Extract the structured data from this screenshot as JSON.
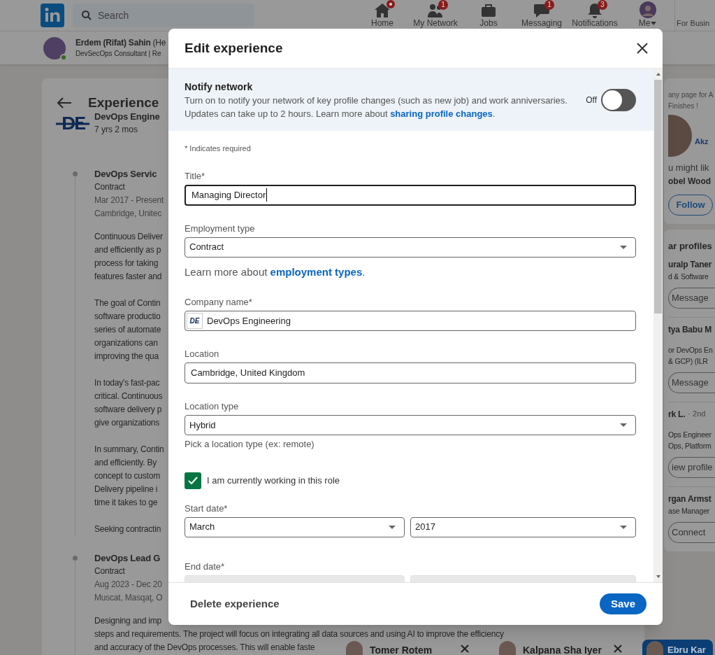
{
  "top_nav": {
    "search_placeholder": "Search",
    "items": [
      {
        "kind": "home",
        "label": "Home",
        "dot": true
      },
      {
        "kind": "network",
        "label": "My Network",
        "badge": "1"
      },
      {
        "kind": "jobs",
        "label": "Jobs"
      },
      {
        "kind": "messaging",
        "label": "Messaging",
        "badge": "1"
      },
      {
        "kind": "notifications",
        "label": "Notifications",
        "badge": "3"
      },
      {
        "kind": "me",
        "label": "Me"
      },
      {
        "kind": "business",
        "label": "For Busin"
      }
    ]
  },
  "profile_bar": {
    "name": "Erdem (Rifat) Sahin",
    "pronouns": "(He",
    "headline": "DevSecOps Consultant | Re",
    "online": true
  },
  "experience": {
    "title": "Experience",
    "company": "DevOps Engine",
    "duration": "7 yrs 2 mos",
    "roles": [
      {
        "title": "DevOps Servic",
        "type": "Contract",
        "dates": "Mar 2017 - Present",
        "location": "Cambridge, Unitec",
        "paragraphs": [
          [
            "Continuous Deliver",
            "and efficiently as p",
            "process for taking",
            "features faster and"
          ],
          [
            "The goal of Contin",
            "software productio",
            "series of automate",
            "organizations can",
            "improving the qua"
          ],
          [
            "In today's fast-pac",
            "critical. Continuous",
            "software delivery p",
            "give organizations"
          ],
          [
            "In summary, Contin",
            "and efficiently. By",
            "concept to custom",
            "Delivery pipeline i",
            "time it takes to ge"
          ],
          [
            "Seeking contractin"
          ]
        ]
      },
      {
        "title": "DevOps Lead G",
        "type": "Contract",
        "dates": "Aug 2023 - Dec 20",
        "location": "Muscat, Masqaţ, O",
        "paragraphs": [
          [
            "Designing and imp",
            "steps and requirements. The project will focus on integrating all data sources and using AI to improve the efficiency",
            "and accuracy of the DevOps processes. This will enable faste"
          ]
        ]
      }
    ]
  },
  "right_rail": {
    "ad_lines": [
      "any page for A",
      "Finishes !"
    ],
    "ad_logo": "Akz",
    "suggestion": "u might lik",
    "person": "obel Wood",
    "follow": "Follow",
    "section_title": "ar profiles",
    "profiles": [
      {
        "name": "uralp Taner",
        "lines": [
          "d & Software"
        ],
        "action": "Message"
      },
      {
        "name": "tya Babu M",
        "lines": [
          "or DevOps En",
          "& GCP) (ILR"
        ],
        "action": "Message"
      },
      {
        "name": "rk L.",
        "degree": "· 2nd",
        "lines": [
          "Ops Engineer",
          "Ops, Platform"
        ],
        "action": "iew profile"
      },
      {
        "name": "rgan Armst",
        "lines": [
          "ase Manager"
        ],
        "action": "Connect"
      }
    ]
  },
  "chat_tabs": [
    {
      "name": "Tomer Rotem",
      "selected": false
    },
    {
      "name": "Kalpana Sha Iyer",
      "selected": false
    },
    {
      "name": "Ebru Kar",
      "selected": true
    }
  ],
  "modal": {
    "title": "Edit experience",
    "notify": {
      "title": "Notify network",
      "line1": "Turn on to notify your network of key profile changes (such as new job) and work anniversaries.",
      "line2": "Updates can take up to 2 hours. Learn more about ",
      "link": "sharing profile changes",
      "suffix": ".",
      "toggle_label": "Off",
      "on": false
    },
    "required_note": "* Indicates required",
    "fields": [
      {
        "kind": "text",
        "label": "Title*",
        "value": "Managing Director",
        "focused": true
      },
      {
        "kind": "select",
        "label": "Employment type",
        "value": "Contract",
        "help": "Learn more about ",
        "help_link": "employment types",
        "help_suffix": "."
      },
      {
        "kind": "company",
        "label": "Company name*",
        "value": "DevOps Engineering",
        "logo": "DE"
      },
      {
        "kind": "text",
        "label": "Location",
        "value": "Cambridge, United Kingdom",
        "focused": false
      },
      {
        "kind": "select",
        "label": "Location type",
        "value": "Hybrid",
        "hint": "Pick a location type (ex: remote)"
      }
    ],
    "current_role": {
      "label": "I am currently working in this role",
      "checked": true
    },
    "start_date": {
      "label": "Start date*",
      "month": "March",
      "year": "2017"
    },
    "end_date": {
      "label": "End date*",
      "disabled": true
    },
    "delete_label": "Delete experience",
    "save_label": "Save"
  }
}
